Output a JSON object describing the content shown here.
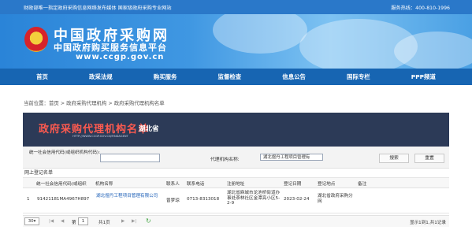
{
  "topbar": {
    "left_text": "财政部唯一指定政府采购信息网络发布媒体 国家级政府采购专业网站",
    "right_text": "服务热线：400-810-1996"
  },
  "banner": {
    "logo_title": "中国政府采购网",
    "logo_subtitle": "中国政府购买服务信息平台",
    "logo_url": "www.ccgp.gov.cn"
  },
  "nav": {
    "items": [
      "首页",
      "政采法规",
      "购买服务",
      "监督检查",
      "信息公告",
      "国际专栏",
      "PPP频道"
    ]
  },
  "breadcrumb": {
    "prefix": "当前位置：",
    "home": "首页",
    "sep1": " > ",
    "level2": "政府采购代理机构",
    "sep2": " > ",
    "level3": "政府采购代理机构名单"
  },
  "panel_header": {
    "title": "政府采购代理机构名单",
    "province": "湖北省",
    "url_small": "HTTP://WWW.CCGP.GOV.CN/FINDAGENT"
  },
  "search": {
    "credit_code_label": "统一社会信用代码(或组织机构代码):",
    "credit_code_value": "",
    "agency_name_label": "代理机构名称:",
    "agency_name_value": "湖北煜丹工程项目管理有",
    "search_button": "搜索",
    "reset_button": "重置"
  },
  "section_title": "网上登记名单",
  "table": {
    "columns": [
      "统一社会信用代码(或组织",
      "机构名称",
      "联系人",
      "联系电话",
      "注册地址",
      "登记日期",
      "登记地点",
      "备注"
    ],
    "rows": [
      {
        "index": "1",
        "code": "91421181MA4967H897",
        "name": "湖北煜丹工程项目管理有限公司",
        "contact": "曾梦琼",
        "phone": "0713-8313018",
        "address": "湖北省麻城市龙池桥街道办事处茶林社区金潭亮小区5-2-9",
        "date": "2023-02-24",
        "place": "湖北省政府采购分网",
        "remark": ""
      }
    ]
  },
  "pagination": {
    "page_size": "30",
    "page_prefix": "第",
    "page_value": "1",
    "page_suffix": "共1页",
    "summary": "显示1到1,共1记录"
  }
}
